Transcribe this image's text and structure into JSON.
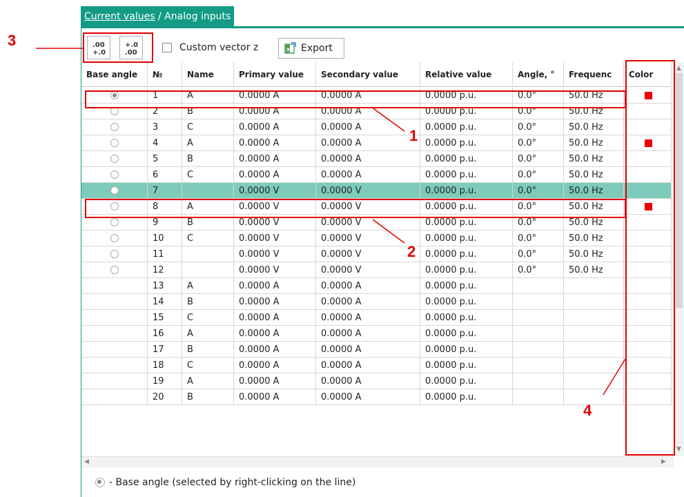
{
  "breadcrumb": {
    "parent": "Current values",
    "separator": " / ",
    "current": "Analog inputs"
  },
  "toolbar": {
    "decimal_inc_label": ".00 +.0",
    "decimal_dec_label": "+.0 .00",
    "custom_vector_label": "Custom vector z",
    "export_label": "Export"
  },
  "table": {
    "columns": [
      "Base angle",
      "№",
      "Name",
      "Primary value",
      "Secondary value",
      "Relative value",
      "Angle, °",
      "Frequenc",
      "Color"
    ],
    "rows": [
      {
        "radio": "selected",
        "num": "1",
        "name": "A",
        "primary": "0.0000 A",
        "secondary": "0.0000 A",
        "relative": "0.0000 p.u.",
        "angle": "0.0°",
        "freq": "50.0 Hz",
        "color": "#ee0000"
      },
      {
        "radio": "empty",
        "num": "2",
        "name": "B",
        "primary": "0.0000 A",
        "secondary": "0.0000 A",
        "relative": "0.0000 p.u.",
        "angle": "0.0°",
        "freq": "50.0 Hz",
        "color": ""
      },
      {
        "radio": "empty",
        "num": "3",
        "name": "C",
        "primary": "0.0000 A",
        "secondary": "0.0000 A",
        "relative": "0.0000 p.u.",
        "angle": "0.0°",
        "freq": "50.0 Hz",
        "color": ""
      },
      {
        "radio": "empty",
        "num": "4",
        "name": "A",
        "primary": "0.0000 A",
        "secondary": "0.0000 A",
        "relative": "0.0000 p.u.",
        "angle": "0.0°",
        "freq": "50.0 Hz",
        "color": "#ee0000"
      },
      {
        "radio": "empty",
        "num": "5",
        "name": "B",
        "primary": "0.0000 A",
        "secondary": "0.0000 A",
        "relative": "0.0000 p.u.",
        "angle": "0.0°",
        "freq": "50.0 Hz",
        "color": ""
      },
      {
        "radio": "empty",
        "num": "6",
        "name": "C",
        "primary": "0.0000 A",
        "secondary": "0.0000 A",
        "relative": "0.0000 p.u.",
        "angle": "0.0°",
        "freq": "50.0 Hz",
        "color": ""
      },
      {
        "radio": "empty",
        "num": "7",
        "name": "",
        "primary": "0.0000 V",
        "secondary": "0.0000 V",
        "relative": "0.0000 p.u.",
        "angle": "0.0°",
        "freq": "50.0 Hz",
        "color": "",
        "selected_row": true
      },
      {
        "radio": "empty",
        "num": "8",
        "name": "A",
        "primary": "0.0000 V",
        "secondary": "0.0000 V",
        "relative": "0.0000 p.u.",
        "angle": "0.0°",
        "freq": "50.0 Hz",
        "color": "#ee0000"
      },
      {
        "radio": "empty",
        "num": "9",
        "name": "B",
        "primary": "0.0000 V",
        "secondary": "0.0000 V",
        "relative": "0.0000 p.u.",
        "angle": "0.0°",
        "freq": "50.0 Hz",
        "color": ""
      },
      {
        "radio": "empty",
        "num": "10",
        "name": "C",
        "primary": "0.0000 V",
        "secondary": "0.0000 V",
        "relative": "0.0000 p.u.",
        "angle": "0.0°",
        "freq": "50.0 Hz",
        "color": ""
      },
      {
        "radio": "empty",
        "num": "11",
        "name": "",
        "primary": "0.0000 V",
        "secondary": "0.0000 V",
        "relative": "0.0000 p.u.",
        "angle": "0.0°",
        "freq": "50.0 Hz",
        "color": ""
      },
      {
        "radio": "empty",
        "num": "12",
        "name": "",
        "primary": "0.0000 V",
        "secondary": "0.0000 V",
        "relative": "0.0000 p.u.",
        "angle": "0.0°",
        "freq": "50.0 Hz",
        "color": ""
      },
      {
        "radio": "none",
        "num": "13",
        "name": "A",
        "primary": "0.0000 A",
        "secondary": "0.0000 A",
        "relative": "0.0000 p.u.",
        "angle": "",
        "freq": "",
        "color": ""
      },
      {
        "radio": "none",
        "num": "14",
        "name": "B",
        "primary": "0.0000 A",
        "secondary": "0.0000 A",
        "relative": "0.0000 p.u.",
        "angle": "",
        "freq": "",
        "color": ""
      },
      {
        "radio": "none",
        "num": "15",
        "name": "C",
        "primary": "0.0000 A",
        "secondary": "0.0000 A",
        "relative": "0.0000 p.u.",
        "angle": "",
        "freq": "",
        "color": ""
      },
      {
        "radio": "none",
        "num": "16",
        "name": "A",
        "primary": "0.0000 A",
        "secondary": "0.0000 A",
        "relative": "0.0000 p.u.",
        "angle": "",
        "freq": "",
        "color": ""
      },
      {
        "radio": "none",
        "num": "17",
        "name": "B",
        "primary": "0.0000 A",
        "secondary": "0.0000 A",
        "relative": "0.0000 p.u.",
        "angle": "",
        "freq": "",
        "color": ""
      },
      {
        "radio": "none",
        "num": "18",
        "name": "C",
        "primary": "0.0000 A",
        "secondary": "0.0000 A",
        "relative": "0.0000 p.u.",
        "angle": "",
        "freq": "",
        "color": ""
      },
      {
        "radio": "none",
        "num": "19",
        "name": "A",
        "primary": "0.0000 A",
        "secondary": "0.0000 A",
        "relative": "0.0000 p.u.",
        "angle": "",
        "freq": "",
        "color": ""
      },
      {
        "radio": "none",
        "num": "20",
        "name": "B",
        "primary": "0.0000 A",
        "secondary": "0.0000 A",
        "relative": "0.0000 p.u.",
        "angle": "",
        "freq": "",
        "color": ""
      }
    ]
  },
  "footer": {
    "legend_text": "- Base angle (selected by right-clicking on the line)"
  },
  "annotations": {
    "labels": [
      "1",
      "2",
      "3",
      "4"
    ],
    "color": "#e00000"
  },
  "theme": {
    "accent": "#139b86",
    "selected_row": "#7ecbbb"
  }
}
